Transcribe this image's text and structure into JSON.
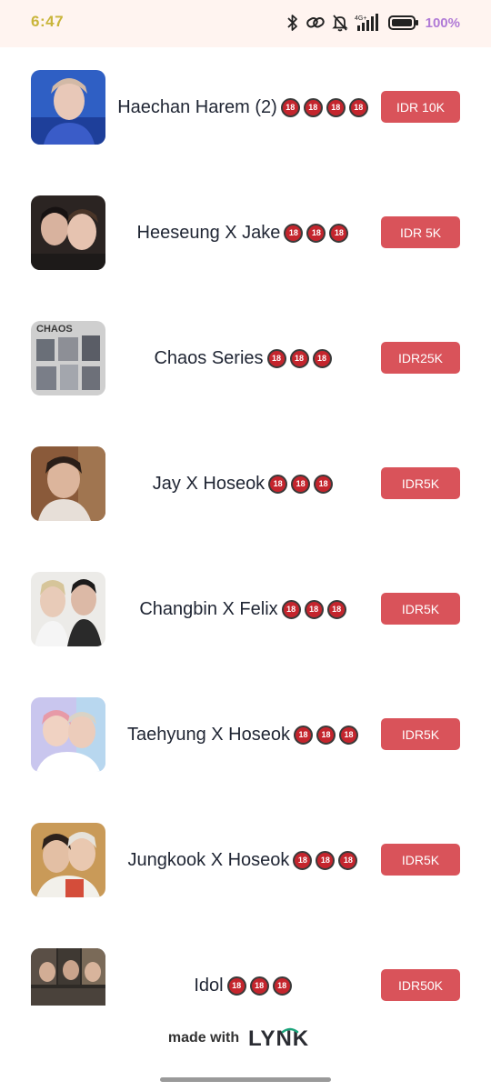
{
  "status_bar": {
    "time": "6:47",
    "network": "4G+",
    "battery": "100%",
    "icons": [
      "bluetooth-icon",
      "link-icon",
      "bell-muted-icon",
      "signal-icon",
      "battery-icon"
    ]
  },
  "badge_text": "18",
  "products": [
    {
      "title": "Haechan Harem (2)",
      "badges": 4,
      "price": "IDR 10K"
    },
    {
      "title": "Heeseung X Jake",
      "badges": 3,
      "price": "IDR 5K"
    },
    {
      "title": "Chaos Series",
      "badges": 3,
      "price": "IDR25K",
      "thumb_text": "CHAOS"
    },
    {
      "title": "Jay X Hoseok",
      "badges": 3,
      "price": "IDR5K"
    },
    {
      "title": "Changbin X Felix",
      "badges": 3,
      "price": "IDR5K"
    },
    {
      "title": "Taehyung X Hoseok",
      "badges": 3,
      "price": "IDR5K"
    },
    {
      "title": "Jungkook X Hoseok",
      "badges": 3,
      "price": "IDR5K"
    },
    {
      "title": "Idol",
      "badges": 3,
      "price": "IDR50K"
    }
  ],
  "footer": {
    "made_with": "made with",
    "brand": "LYNK"
  },
  "colors": {
    "button": "#d9535a",
    "badge": "#c4252d",
    "logo": "#2b2d33",
    "logo_accent": "#1aa37a"
  }
}
